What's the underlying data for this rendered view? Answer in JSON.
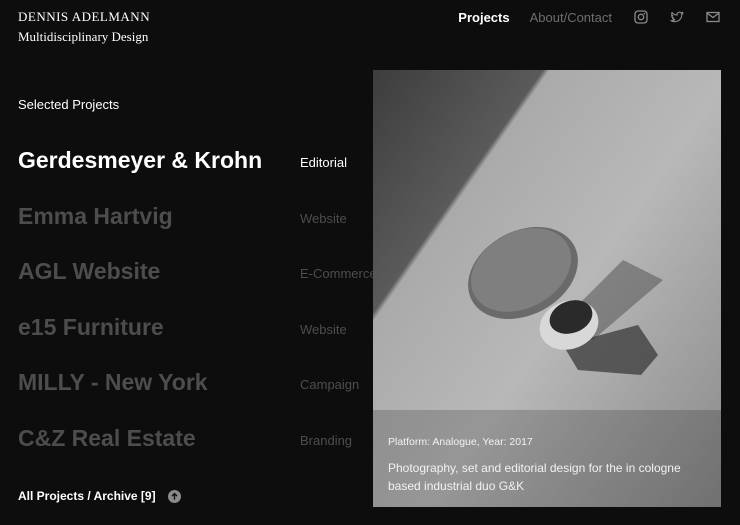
{
  "brand": {
    "name": "DENNIS ADELMANN",
    "subtitle": "Multidisciplinary Design"
  },
  "nav": {
    "projects": "Projects",
    "about": "About/Contact",
    "icons": [
      "instagram-icon",
      "twitter-icon",
      "mail-icon"
    ]
  },
  "section_title": "Selected Projects",
  "projects": [
    {
      "name": "Gerdesmeyer & Krohn",
      "category": "Editorial",
      "active": true
    },
    {
      "name": "Emma Hartvig",
      "category": "Website",
      "active": false
    },
    {
      "name": "AGL Website",
      "category": "E-Commerce",
      "active": false
    },
    {
      "name": "e15 Furniture",
      "category": "Website",
      "active": false
    },
    {
      "name": "MILLY - New York",
      "category": "Campaign",
      "active": false
    },
    {
      "name": "C&Z Real Estate",
      "category": "Branding",
      "active": false
    }
  ],
  "archive": {
    "label": "All Projects / Archive [9]"
  },
  "preview": {
    "meta": "Platform: Analogue, Year: 2017",
    "description": "Photography, set and editorial design for the in cologne based industrial duo G&K"
  },
  "colors": {
    "background": "#0d0d0d",
    "active_text": "#ffffff",
    "inactive_text": "#4d4d4d",
    "nav_inactive": "#6e6e6e"
  }
}
